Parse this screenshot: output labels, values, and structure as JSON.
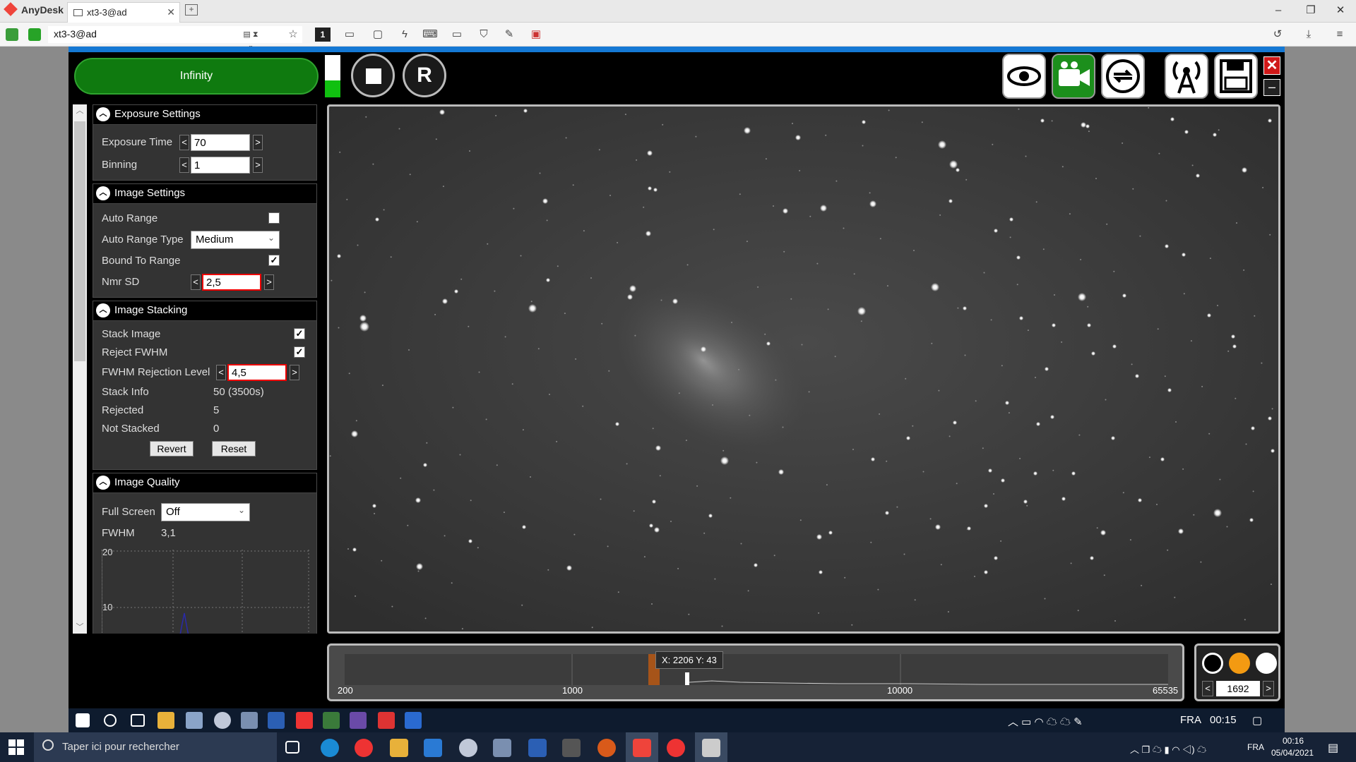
{
  "anydesk": {
    "brand": "AnyDesk",
    "tab_title": "xt3-3@ad",
    "address": "xt3-3@ad",
    "monitor_number": "1"
  },
  "app": {
    "infinity_label": "Infinity",
    "r_label": "R",
    "exposure_progress": 0.4
  },
  "panels": {
    "exposure": {
      "title": "Exposure Settings",
      "exposure_time_label": "Exposure Time",
      "exposure_time_value": "70",
      "binning_label": "Binning",
      "binning_value": "1"
    },
    "image_settings": {
      "title": "Image Settings",
      "auto_range_label": "Auto Range",
      "auto_range_checked": false,
      "auto_range_type_label": "Auto Range Type",
      "auto_range_type_value": "Medium",
      "bound_to_range_label": "Bound To Range",
      "bound_to_range_checked": true,
      "nmr_sd_label": "Nmr SD",
      "nmr_sd_value": "2,5"
    },
    "stacking": {
      "title": "Image Stacking",
      "stack_image_label": "Stack Image",
      "stack_image_checked": true,
      "reject_fwhm_label": "Reject FWHM",
      "reject_fwhm_checked": true,
      "fwhm_rejection_label": "FWHM Rejection Level",
      "fwhm_rejection_value": "4,5",
      "stack_info_label": "Stack Info",
      "stack_info_value": "50 (3500s)",
      "rejected_label": "Rejected",
      "rejected_value": "5",
      "not_stacked_label": "Not Stacked",
      "not_stacked_value": "0",
      "revert_label": "Revert",
      "reset_label": "Reset"
    },
    "quality": {
      "title": "Image Quality",
      "full_screen_label": "Full Screen",
      "full_screen_value": "Off",
      "fwhm_label": "FWHM",
      "fwhm_value": "3,1",
      "graph_y_top": "20",
      "graph_y_mid": "10"
    }
  },
  "histogram": {
    "tick_200": "200",
    "tick_1000": "1000",
    "tick_10000": "10000",
    "tick_65535": "65535",
    "tooltip": "X: 2206 Y: 43"
  },
  "display": {
    "value": "1692",
    "colors": [
      "#000000",
      "#f39a12",
      "#ffffff"
    ]
  },
  "remote_taskbar": {
    "lang": "FRA",
    "time": "00:15"
  },
  "local_taskbar": {
    "search_placeholder": "Taper ici pour rechercher",
    "lang": "FRA",
    "time": "00:16",
    "date": "05/04/2021"
  },
  "arrows": {
    "left": "<",
    "right": ">"
  }
}
